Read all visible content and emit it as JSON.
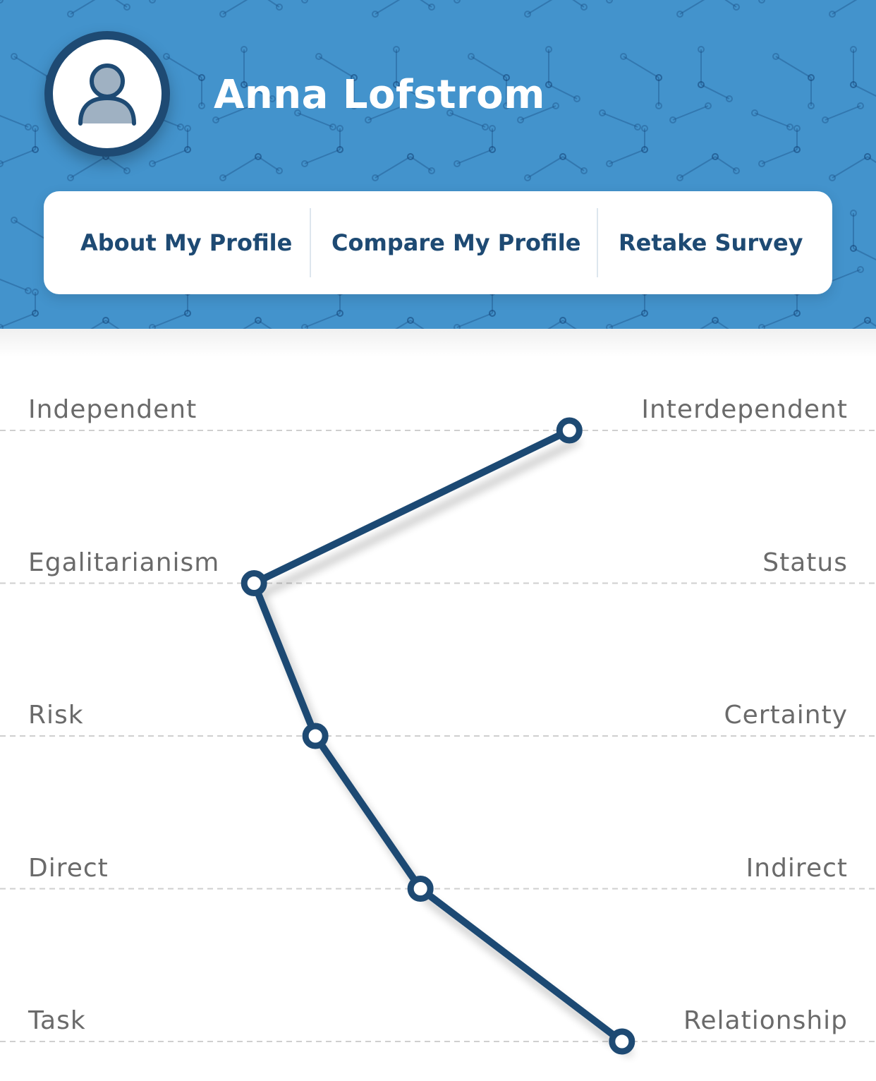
{
  "profile": {
    "name": "Anna Lofstrom",
    "avatar_icon": "user-icon"
  },
  "nav": {
    "about_label": "About My Profile",
    "compare_label": "Compare My Profile",
    "retake_label": "Retake Survey"
  },
  "colors": {
    "header_bg": "#4393cc",
    "accent": "#1e4a73",
    "label_text": "#6a6a6a",
    "dashed_line": "#cfcfcf"
  },
  "chart_data": {
    "type": "line",
    "orientation": "horizontal-scale-per-row",
    "dimensions": [
      {
        "left": "Independent",
        "right": "Interdependent",
        "value": 0.65
      },
      {
        "left": "Egalitarianism",
        "right": "Status",
        "value": 0.29
      },
      {
        "left": "Risk",
        "right": "Certainty",
        "value": 0.36
      },
      {
        "left": "Direct",
        "right": "Indirect",
        "value": 0.48
      },
      {
        "left": "Task",
        "right": "Relationship",
        "value": 0.71
      }
    ],
    "value_range": [
      0,
      1
    ],
    "grid": true
  }
}
